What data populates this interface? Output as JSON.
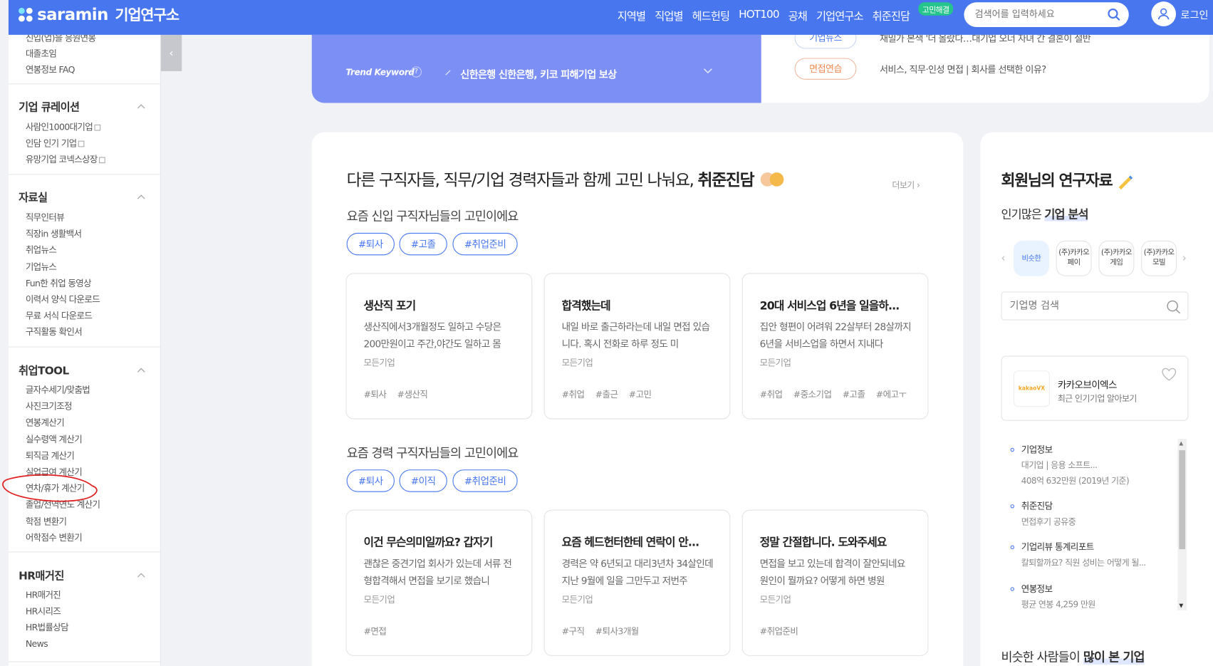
{
  "header": {
    "logo": "saramin",
    "logo_sub": "기업연구소",
    "nav": [
      "지역별",
      "직업별",
      "헤드헌팅",
      "HOT100",
      "공채",
      "기업연구소",
      "취준진담"
    ],
    "nav_badge": "고민해결",
    "search_placeholder": "검색어를 입력하세요",
    "login": "로그인"
  },
  "sidebar": {
    "top_items": [
      "신입(업)을 응원연봉",
      "대졸초임",
      "연봉정보 FAQ"
    ],
    "sections": [
      {
        "title": "기업 큐레이션",
        "items": [
          "사람인1000대기업",
          "인담 인기 기업",
          "유망기업 코넥스상장"
        ]
      },
      {
        "title": "자료실",
        "items": [
          "직무인터뷰",
          "직장in 생활백서",
          "취업뉴스",
          "기업뉴스",
          "Fun한 취업 동영상",
          "이력서 양식 다운로드",
          "무료 서식 다운로드",
          "구직활동 확인서"
        ]
      },
      {
        "title": "취업TOOL",
        "items": [
          "글자수세기/맞춤법",
          "사진크기조정",
          "연봉계산기",
          "실수령액 계산기",
          "퇴직금 계산기",
          "실업급여 계산기",
          "연차/휴가 계산기",
          "졸업/전역연도 계산기",
          "학점 변환기",
          "어학점수 변환기"
        ]
      },
      {
        "title": "HR매거진",
        "items": [
          "HR매거진",
          "HR시리즈",
          "HR법률상담",
          "News"
        ]
      }
    ],
    "collapse_glyph": "‹"
  },
  "banner": {
    "top_news": "기업뉴스",
    "top_news_text": "재밀가 본색 '더 올랐다…대기업 오너 자녀 간 결혼이 절반",
    "trend_label": "Trend Keyword",
    "trend_help": "?",
    "trend_keyword": "신한은행 신한은행, 키코 피해기업 보상",
    "interview_pill": "면접연습",
    "interview_text": "서비스, 직무·인성 면접 | 회사를 선택한 이유?"
  },
  "main": {
    "title_pre": "다른 구직자들, 직무/기업 경력자들과 함께 고민 나눠요,",
    "title_bold": "취준진담",
    "more": "더보기 ›",
    "groups": [
      {
        "heading": "요즘 신입 구직자님들의 고민이에요",
        "tags": [
          "#퇴사",
          "#고졸",
          "#취업준비"
        ],
        "cards": [
          {
            "title": "생산직 포기",
            "desc": "생산직에서3개월정도 일하고 수당은 200만원이고 주간,야간도 일하고 몸",
            "company": "모든기업",
            "hashtags": [
              "#퇴사",
              "#생산직"
            ]
          },
          {
            "title": "합격했는데",
            "desc": "내일 바로 출근하라는데 내일 면접 있습니다. 혹시 전화로 하루 정도 미",
            "company": "모든기업",
            "hashtags": [
              "#취업",
              "#출근",
              "#고민"
            ]
          },
          {
            "title": "20대 서비스업 6년을 일을하...",
            "desc": "집안 형편이 어려워 22살부터 28살까지 6년을 서비스업을 하면서 지내다",
            "company": "모든기업",
            "hashtags": [
              "#취업",
              "#중소기업",
              "#고졸",
              "#에고ㅜ"
            ]
          }
        ]
      },
      {
        "heading": "요즘 경력 구직자님들의 고민이에요",
        "tags": [
          "#퇴사",
          "#이직",
          "#취업준비"
        ],
        "cards": [
          {
            "title": "이건 무슨의미일까요? 갑자기",
            "desc": "괜찮은 중견기업 회사가 있는데 서류 전형합격해서 면접을 보기로 했습니",
            "company": "모든기업",
            "hashtags": [
              "#면접"
            ]
          },
          {
            "title": "요즘 헤드헌터한테 연락이 안...",
            "desc": "경력은 약 6년되고 대리3년차 34살인데 지난 9월에 일을 그만두고 저번주",
            "company": "모든기업",
            "hashtags": [
              "#구직",
              "#퇴사3개월"
            ]
          },
          {
            "title": "정말 간절합니다. 도와주세요",
            "desc": "면접을 보고 있는데 합격이 잘안되네요 원인이 뭘까요? 어떻게 하면 병원",
            "company": "모든기업",
            "hashtags": [
              "#취업준비"
            ]
          }
        ]
      }
    ]
  },
  "right": {
    "title": "회원님의 연구자료",
    "sub_pre": "인기많은",
    "sub_bold": "기업 분석",
    "chips": [
      {
        "label": "비슷한",
        "active": true
      },
      {
        "label": "(주)카카오페이",
        "active": false
      },
      {
        "label": "(주)카카오게임",
        "active": false
      },
      {
        "label": "(주)카카오모빌",
        "active": false
      }
    ],
    "company_search_placeholder": "기업명 검색",
    "company": {
      "logo_text": "kakaoVX",
      "name": "카카오브이엑스",
      "desc": "최근 인기기업 알아보기"
    },
    "info": [
      {
        "title": "기업정보",
        "subs": [
          "대기업 | 응용 소프트...",
          "408억 632만원 (2019년 기준)"
        ]
      },
      {
        "title": "취준진담",
        "subs": [
          "면접후기 공유중"
        ]
      },
      {
        "title": "기업리뷰 통계리포트",
        "subs": [
          "칼퇴할까요? 직원 성비는 어떻게 될..."
        ]
      },
      {
        "title": "연봉정보",
        "subs": [
          "평균 연봉 4,259 만원"
        ]
      }
    ],
    "similar_pre": "비슷한 사람들이",
    "similar_bold": "많이 본 기업"
  },
  "colors": {
    "brand": "#4876ef",
    "banner": "#7c8ff5",
    "accent_green": "#25c48c",
    "pill_orange": "#f08a54",
    "annotation_red": "#e02020"
  }
}
